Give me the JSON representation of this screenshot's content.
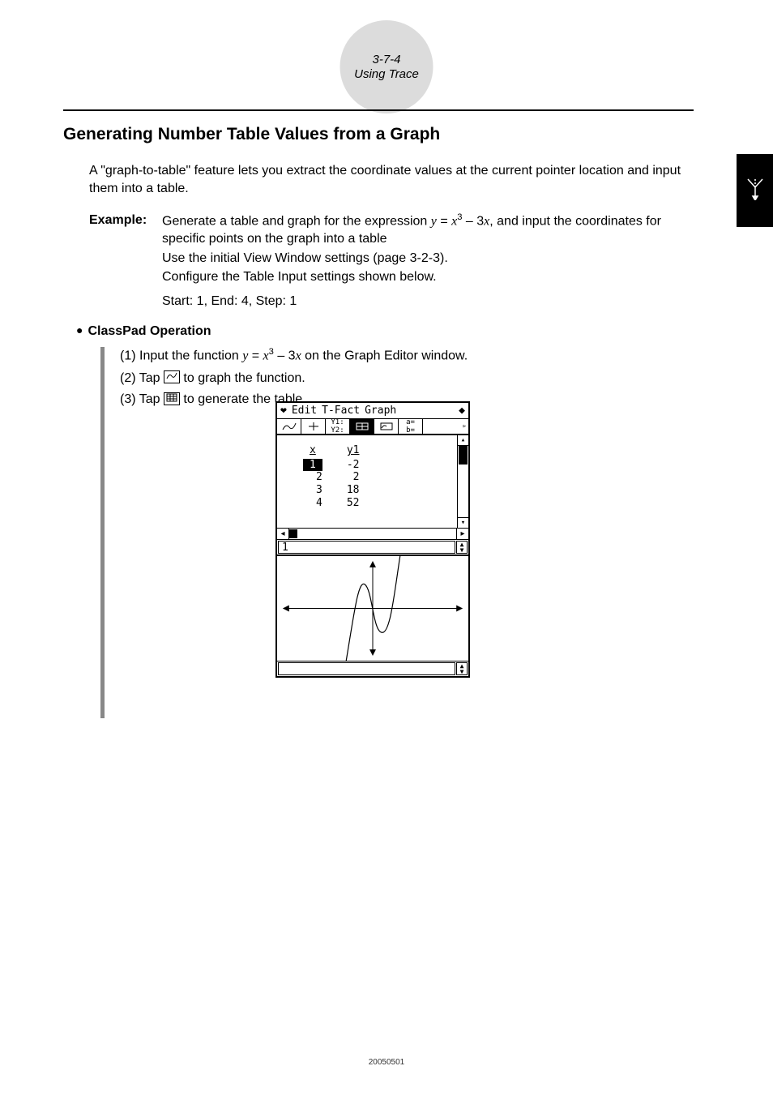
{
  "page_header": {
    "section_number": "3-7-4",
    "section_title": "Using Trace"
  },
  "heading": "Generating Number Table Values from a Graph",
  "intro": "A \"graph-to-table\" feature lets you extract the coordinate values at the current pointer location and input them into a table.",
  "example": {
    "label": "Example:",
    "line1_prefix": "Generate a table and graph for the expression ",
    "expr_y": "y",
    "expr_eq": " = ",
    "expr_x": "x",
    "expr_pow": "3",
    "expr_minus": " – 3",
    "expr_x2": "x",
    "line1_suffix": ", and input the coordinates for specific points on the graph into a table",
    "line2": "Use the initial View Window settings (page 3-2-3).",
    "line3": "Configure the Table Input settings shown below.",
    "start_end": "Start: 1,   End: 4,   Step: 1"
  },
  "operation": {
    "heading": "ClassPad Operation",
    "step1_prefix": "(1) Input the function ",
    "step1_y": "y",
    "step1_eq": " = ",
    "step1_x": "x",
    "step1_pow": "3",
    "step1_mid": " – 3",
    "step1_x2": "x",
    "step1_suffix": " on the Graph Editor window.",
    "step2_prefix": "(2) Tap ",
    "step2_suffix": " to graph the function.",
    "step3_prefix": "(3) Tap ",
    "step3_suffix": " to generate the table."
  },
  "calc": {
    "menu": {
      "edit": "Edit",
      "tfact": "T-Fact",
      "graph": "Graph"
    },
    "table": {
      "headers": [
        "x",
        "y1"
      ],
      "rows": [
        {
          "x": "1",
          "y": "-2"
        },
        {
          "x": "2",
          "y": "2"
        },
        {
          "x": "3",
          "y": "18"
        },
        {
          "x": "4",
          "y": "52"
        }
      ]
    },
    "selected_value": "1"
  },
  "chart_data": {
    "type": "line",
    "title": "",
    "xlabel": "",
    "ylabel": "",
    "xlim": [
      -7.7,
      7.7
    ],
    "ylim": [
      -3.8,
      3.8
    ],
    "series": [
      {
        "name": "y = x^3 - 3x",
        "x": [
          -2.2,
          -2.0,
          -1.73,
          -1.5,
          -1.0,
          -0.5,
          0.0,
          0.5,
          1.0,
          1.5,
          1.73,
          2.0,
          2.2
        ],
        "y": [
          -4.05,
          -2.0,
          0.0,
          1.13,
          2.0,
          1.38,
          0.0,
          -1.38,
          -2.0,
          -1.13,
          0.0,
          2.0,
          4.05
        ]
      }
    ],
    "note": "Cubic curve y = x^3 - 3x; local max at x≈-1 (y=2), local min at x≈1 (y=-2); axes with arrowheads, no grid."
  },
  "footer": "20050501"
}
